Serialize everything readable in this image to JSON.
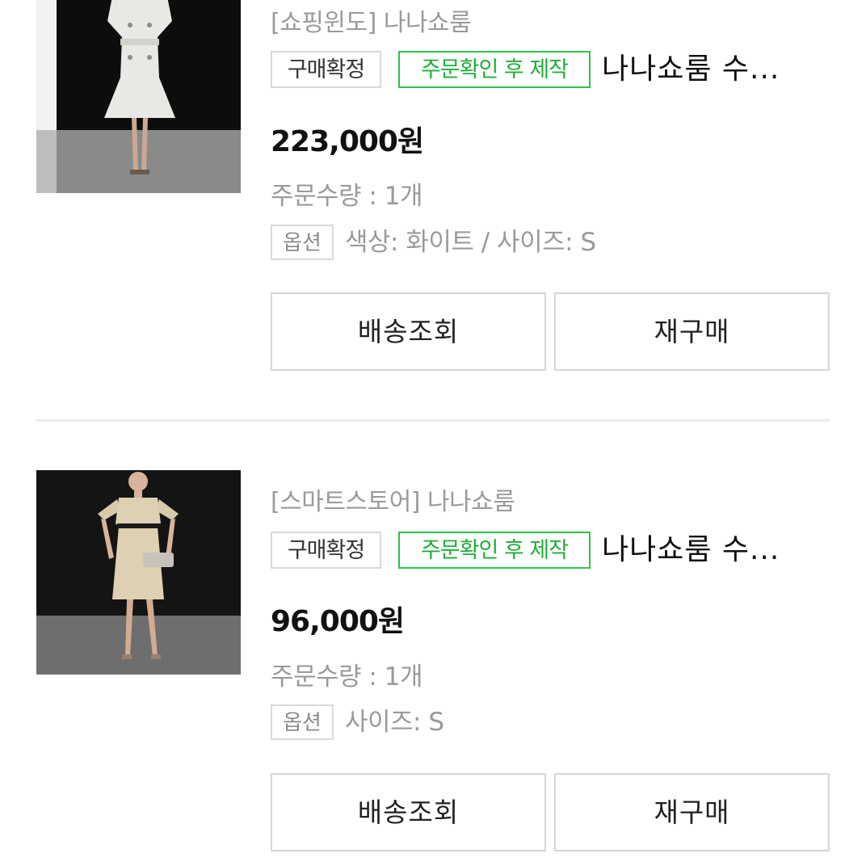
{
  "orders": [
    {
      "store": "[쇼핑윈도] 나나쇼룸",
      "status_badge": "구매확정",
      "production_badge": "주문확인 후 제작",
      "product_name": "나나쇼룸 수...",
      "price": "223,000원",
      "quantity": "주문수량 : 1개",
      "option_tag": "옵션",
      "option_text": "색상: 화이트 / 사이즈: S",
      "track_button": "배송조회",
      "rebuy_button": "재구매"
    },
    {
      "store": "[스마트스토어] 나나쇼룸",
      "status_badge": "구매확정",
      "production_badge": "주문확인 후 제작",
      "product_name": "나나쇼룸 수...",
      "price": "96,000원",
      "quantity": "주문수량 : 1개",
      "option_tag": "옵션",
      "option_text": "사이즈: S",
      "track_button": "배송조회",
      "rebuy_button": "재구매"
    }
  ],
  "colors": {
    "accent_green": "#1fae38",
    "muted_text": "#9a9a9a",
    "border": "#d9d9d9"
  }
}
